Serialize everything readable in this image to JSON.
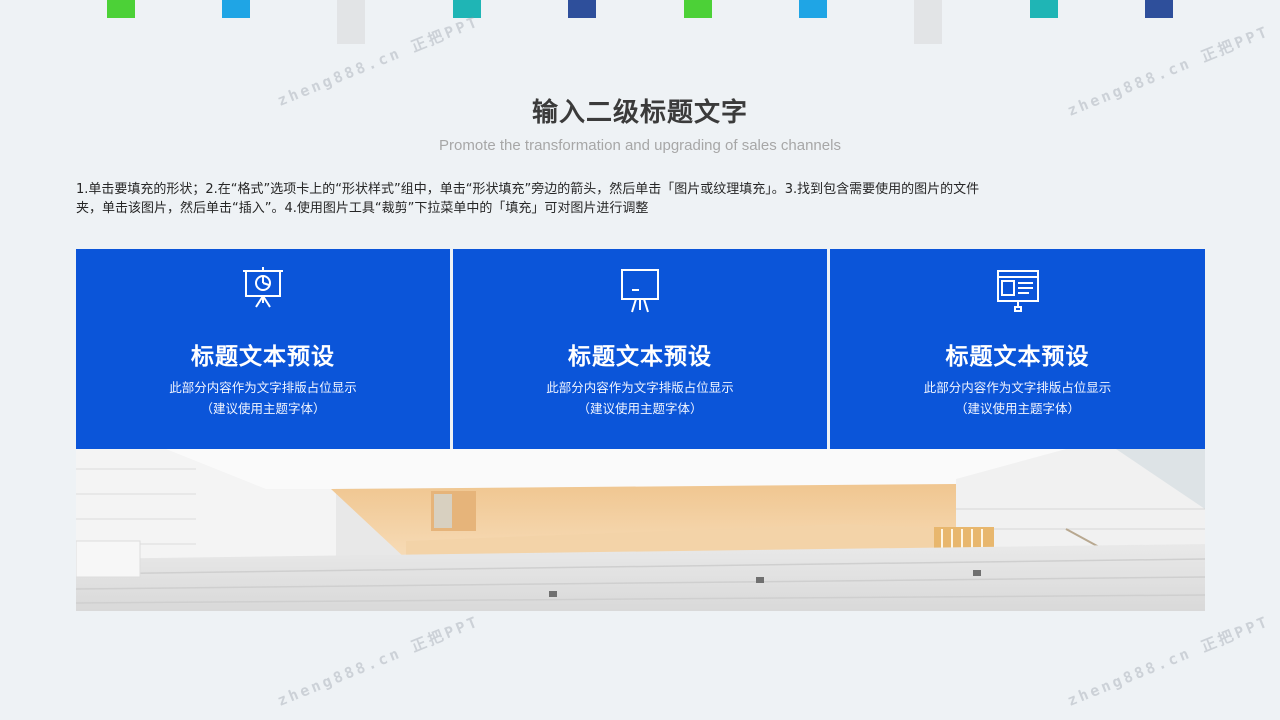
{
  "top_blocks": [
    {
      "color": "#4cd137",
      "kind": "color"
    },
    {
      "color": "#1fa5e5",
      "kind": "color"
    },
    {
      "color": "#e2e4e6",
      "kind": "gray"
    },
    {
      "color": "#1fb5b5",
      "kind": "color"
    },
    {
      "color": "#2e4f9b",
      "kind": "color"
    },
    {
      "color": "#4cd137",
      "kind": "color"
    },
    {
      "color": "#1fa5e5",
      "kind": "color"
    },
    {
      "color": "#e2e4e6",
      "kind": "gray"
    },
    {
      "color": "#1fb5b5",
      "kind": "color"
    },
    {
      "color": "#2e4f9b",
      "kind": "color"
    }
  ],
  "header": {
    "title": "输入二级标题文字",
    "subtitle": "Promote the transformation  and upgrading of sales channels"
  },
  "description": {
    "line1": "1.单击要填充的形状；2.在“格式”选项卡上的“形状样式”组中，单击“形状填充”旁边的箭头，然后单击「图片或纹理填充」。3.找到包含需要使用的图片的文件",
    "line2": "夹，单击该图片，然后单击“插入”。4.使用图片工具“裁剪”下拉菜单中的「填充」可对图片进行调整"
  },
  "cards": [
    {
      "icon": "presentation-chart-icon",
      "title": "标题文本预设",
      "line1": "此部分内容作为文字排版占位显示",
      "line2": "（建议使用主题字体）"
    },
    {
      "icon": "blackboard-icon",
      "title": "标题文本预设",
      "line1": "此部分内容作为文字排版占位显示",
      "line2": "（建议使用主题字体）"
    },
    {
      "icon": "monitor-dashboard-icon",
      "title": "标题文本预设",
      "line1": "此部分内容作为文字排版占位显示",
      "line2": "（建议使用主题字体）"
    }
  ],
  "colors": {
    "card_blue": "#0b55d9",
    "background": "#eef2f5"
  },
  "watermark": "zheng888.cn 正把PPT"
}
